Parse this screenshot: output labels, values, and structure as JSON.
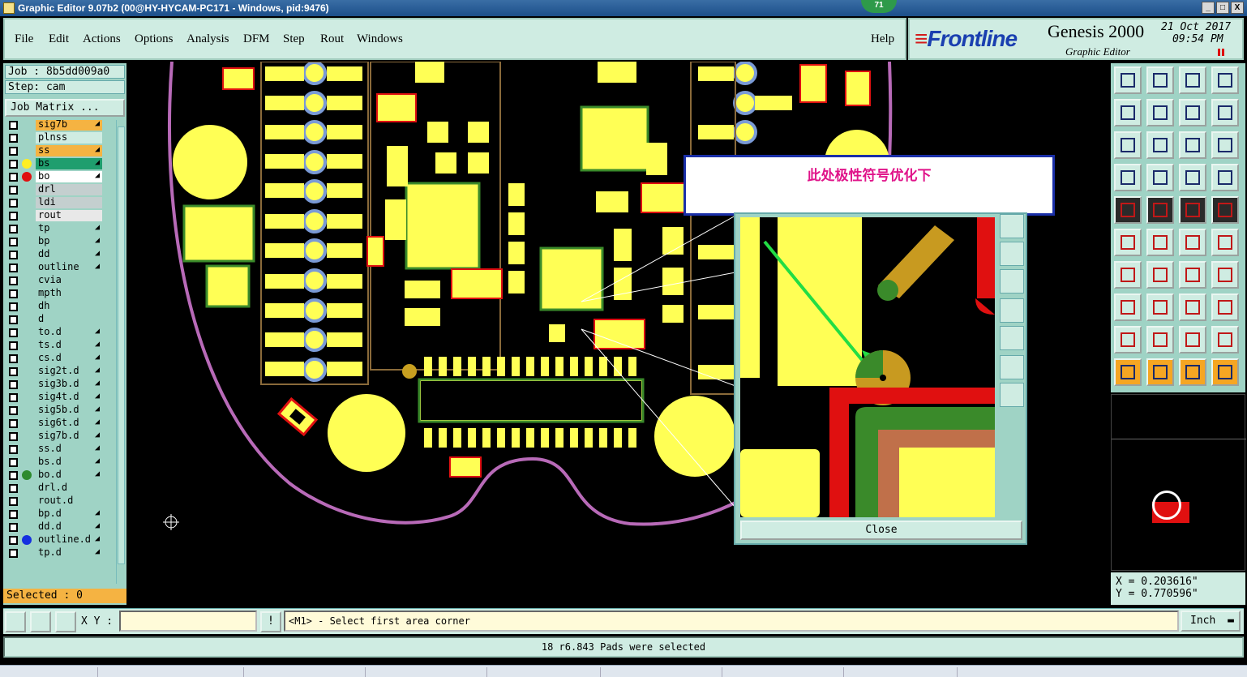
{
  "window": {
    "title": "Graphic Editor 9.07b2 (00@HY-HYCAM-PC171 - Windows, pid:9476)",
    "badge": "71",
    "min_label": "_",
    "max_label": "□",
    "close_label": "X"
  },
  "menu": {
    "items": [
      "File",
      "Edit",
      "Actions",
      "Options",
      "Analysis",
      "DFM",
      "Step",
      "Rout",
      "Windows"
    ],
    "help": "Help"
  },
  "brand": {
    "logo": "Frontline",
    "product": "Genesis 2000",
    "subtitle": "Graphic Editor",
    "date": "21 Oct 2017",
    "time": "09:54 PM"
  },
  "job": {
    "job_line": "Job : 8b5dd009a0",
    "step_line": "Step: cam",
    "job_matrix_button": "Job Matrix ...",
    "selected": "Selected : 0"
  },
  "layers": [
    {
      "name": "sig7b",
      "bg": "#f5b342",
      "dot": "",
      "tic": "◢"
    },
    {
      "name": "plnss",
      "bg": "#cfece2",
      "dot": "",
      "tic": ""
    },
    {
      "name": "ss",
      "bg": "#f5b342",
      "dot": "",
      "tic": "◢"
    },
    {
      "name": "bs",
      "bg": "#1f9e6e",
      "dot": "#ffee22",
      "tic": "◢"
    },
    {
      "name": "bo",
      "bg": "#ffffff",
      "dot": "#e01010",
      "tic": "◢"
    },
    {
      "name": "drl",
      "bg": "#c4cfcf",
      "dot": "",
      "tic": ""
    },
    {
      "name": "ldi",
      "bg": "#c4cfcf",
      "dot": "",
      "tic": ""
    },
    {
      "name": "rout",
      "bg": "#e8e8e8",
      "dot": "",
      "tic": ""
    },
    {
      "name": "tp",
      "bg": "#9fd3c5",
      "dot": "",
      "tic": "◢"
    },
    {
      "name": "bp",
      "bg": "#9fd3c5",
      "dot": "",
      "tic": "◢"
    },
    {
      "name": "dd",
      "bg": "#9fd3c5",
      "dot": "",
      "tic": "◢"
    },
    {
      "name": "outline",
      "bg": "#9fd3c5",
      "dot": "",
      "tic": "◢"
    },
    {
      "name": "cvia",
      "bg": "#9fd3c5",
      "dot": "",
      "tic": ""
    },
    {
      "name": "mpth",
      "bg": "#9fd3c5",
      "dot": "",
      "tic": ""
    },
    {
      "name": "dh",
      "bg": "#9fd3c5",
      "dot": "",
      "tic": ""
    },
    {
      "name": "d",
      "bg": "#9fd3c5",
      "dot": "",
      "tic": ""
    },
    {
      "name": "to.d",
      "bg": "#9fd3c5",
      "dot": "",
      "tic": "◢"
    },
    {
      "name": "ts.d",
      "bg": "#9fd3c5",
      "dot": "",
      "tic": "◢"
    },
    {
      "name": "cs.d",
      "bg": "#9fd3c5",
      "dot": "",
      "tic": "◢"
    },
    {
      "name": "sig2t.d",
      "bg": "#9fd3c5",
      "dot": "",
      "tic": "◢"
    },
    {
      "name": "sig3b.d",
      "bg": "#9fd3c5",
      "dot": "",
      "tic": "◢"
    },
    {
      "name": "sig4t.d",
      "bg": "#9fd3c5",
      "dot": "",
      "tic": "◢"
    },
    {
      "name": "sig5b.d",
      "bg": "#9fd3c5",
      "dot": "",
      "tic": "◢"
    },
    {
      "name": "sig6t.d",
      "bg": "#9fd3c5",
      "dot": "",
      "tic": "◢"
    },
    {
      "name": "sig7b.d",
      "bg": "#9fd3c5",
      "dot": "",
      "tic": "◢"
    },
    {
      "name": "ss.d",
      "bg": "#9fd3c5",
      "dot": "",
      "tic": "◢"
    },
    {
      "name": "bs.d",
      "bg": "#9fd3c5",
      "dot": "",
      "tic": "◢"
    },
    {
      "name": "bo.d",
      "bg": "#9fd3c5",
      "dot": "#2e8b2e",
      "tic": "◢"
    },
    {
      "name": "drl.d",
      "bg": "#9fd3c5",
      "dot": "",
      "tic": ""
    },
    {
      "name": "rout.d",
      "bg": "#9fd3c5",
      "dot": "",
      "tic": ""
    },
    {
      "name": "bp.d",
      "bg": "#9fd3c5",
      "dot": "",
      "tic": "◢"
    },
    {
      "name": "dd.d",
      "bg": "#9fd3c5",
      "dot": "",
      "tic": "◢"
    },
    {
      "name": "outline.d",
      "bg": "#9fd3c5",
      "dot": "#1530e0",
      "tic": "◢"
    },
    {
      "name": "tp.d",
      "bg": "#9fd3c5",
      "dot": "",
      "tic": "◢"
    }
  ],
  "popup": {
    "message": "此处极性符号优化下"
  },
  "zoom": {
    "close_label": "Close"
  },
  "toolbox": {
    "icons": [
      "zoom-home-icon",
      "zoom-page-icon",
      "zoom-fit-icon",
      "zoom-area-icon",
      "pan-left-icon",
      "pan-right-icon",
      "undo-view-icon",
      "redraw-icon",
      "zoom-in-icon",
      "zoom-out-icon",
      "zoom-one-to-one-icon",
      "help-icon",
      "measure-icon",
      "grid-icon",
      "layer-stack-icon",
      "layer-stack-alt-icon",
      "add-pad-icon",
      "add-line-icon",
      "ruler-icon",
      "snap-point-icon",
      "connect-nodes-icon",
      "delete-icon",
      "move-icon",
      "copy-icon",
      "draw-line-icon",
      "draw-diagonal-icon",
      "draw-arc-icon",
      "mirror-icon",
      "resize-icon",
      "split-icon",
      "contour-icon",
      "polygon-icon",
      "angle-icon",
      "triangle-icon",
      "arch-icon",
      "cross-angle-icon",
      "select-arrow-icon",
      "select-rect-icon",
      "select-lasso-icon",
      "route-select-icon"
    ]
  },
  "coords": {
    "x": "X = 0.203616\"",
    "y": "Y = 0.770596\""
  },
  "command": {
    "xy_label": "X Y :",
    "xy_value": "",
    "info_label": "!",
    "prompt": "<M1> - Select first area corner",
    "unit": "Inch"
  },
  "status": {
    "message": "18 r6.843 Pads were selected"
  }
}
